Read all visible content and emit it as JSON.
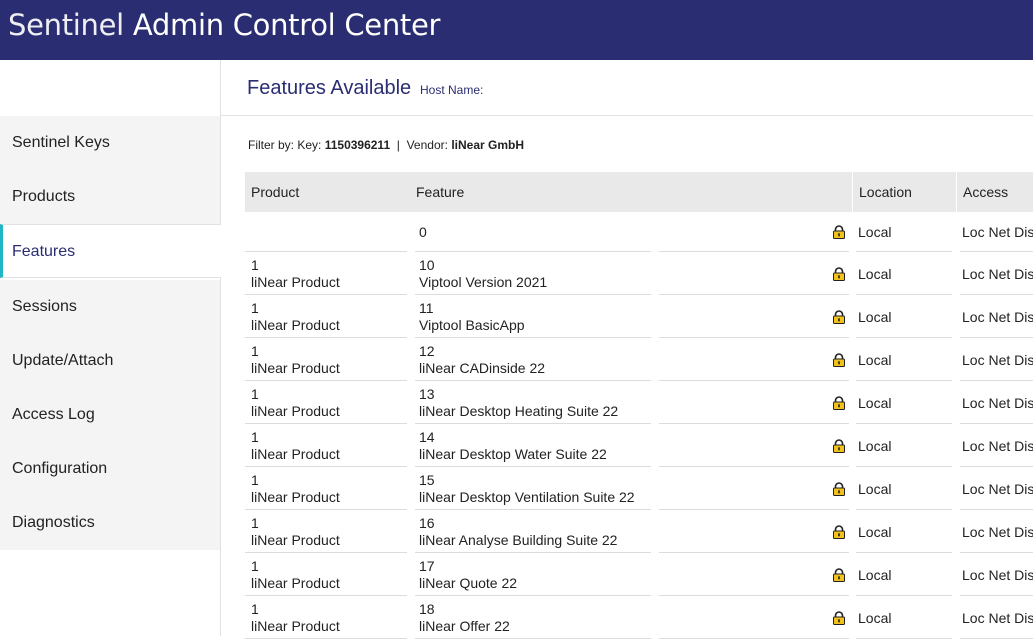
{
  "header": {
    "title_light": "Sentinel",
    "title_bold": "Admin Control Center"
  },
  "sidebar": {
    "items": [
      {
        "label": "Sentinel Keys",
        "active": false
      },
      {
        "label": "Products",
        "active": false
      },
      {
        "label": "Features",
        "active": true
      },
      {
        "label": "Sessions",
        "active": false
      },
      {
        "label": "Update/Attach",
        "active": false
      },
      {
        "label": "Access Log",
        "active": false
      },
      {
        "label": "Configuration",
        "active": false
      },
      {
        "label": "Diagnostics",
        "active": false
      }
    ]
  },
  "main": {
    "title": "Features Available",
    "host_label": "Host Name:",
    "filter": {
      "prefix": "Filter by: Key:",
      "key": "1150396211",
      "separator": "|",
      "vendor_label": "Vendor:",
      "vendor": "liNear GmbH"
    },
    "table": {
      "headers": [
        "Product",
        "Feature",
        "Location",
        "Access"
      ],
      "rows": [
        {
          "product_id": "",
          "product_name": "",
          "feature_id": "0",
          "feature_name": "",
          "location": "Local",
          "access": "Loc Net Dis"
        },
        {
          "product_id": "1",
          "product_name": "liNear Product",
          "feature_id": "10",
          "feature_name": "Viptool Version 2021",
          "location": "Local",
          "access": "Loc Net Dis"
        },
        {
          "product_id": "1",
          "product_name": "liNear Product",
          "feature_id": "11",
          "feature_name": "Viptool BasicApp",
          "location": "Local",
          "access": "Loc Net Dis"
        },
        {
          "product_id": "1",
          "product_name": "liNear Product",
          "feature_id": "12",
          "feature_name": "liNear CADinside 22",
          "location": "Local",
          "access": "Loc Net Dis"
        },
        {
          "product_id": "1",
          "product_name": "liNear Product",
          "feature_id": "13",
          "feature_name": "liNear Desktop Heating Suite 22",
          "location": "Local",
          "access": "Loc Net Dis"
        },
        {
          "product_id": "1",
          "product_name": "liNear Product",
          "feature_id": "14",
          "feature_name": "liNear Desktop Water Suite 22",
          "location": "Local",
          "access": "Loc Net Dis"
        },
        {
          "product_id": "1",
          "product_name": "liNear Product",
          "feature_id": "15",
          "feature_name": "liNear Desktop Ventilation Suite 22",
          "location": "Local",
          "access": "Loc Net Dis"
        },
        {
          "product_id": "1",
          "product_name": "liNear Product",
          "feature_id": "16",
          "feature_name": "liNear Analyse Building Suite 22",
          "location": "Local",
          "access": "Loc Net Dis"
        },
        {
          "product_id": "1",
          "product_name": "liNear Product",
          "feature_id": "17",
          "feature_name": "liNear Quote 22",
          "location": "Local",
          "access": "Loc Net Dis"
        },
        {
          "product_id": "1",
          "product_name": "liNear Product",
          "feature_id": "18",
          "feature_name": "liNear Offer 22",
          "location": "Local",
          "access": "Loc Net Dis"
        }
      ],
      "location_icon": "lock-icon"
    }
  },
  "colors": {
    "topbar": "#2a2d72",
    "accent": "#1fb7c6",
    "lock_body": "#f2c21b"
  }
}
